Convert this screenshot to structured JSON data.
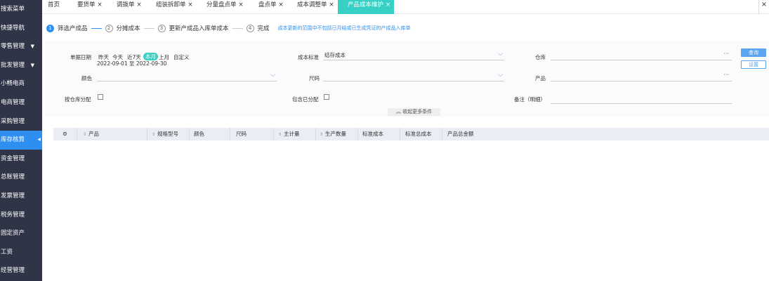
{
  "sidebar": {
    "items": [
      {
        "label": "搜索菜单"
      },
      {
        "label": "快捷导航"
      },
      {
        "label": "零售管理",
        "caret": "▼"
      },
      {
        "label": "批发管理",
        "caret": "▼"
      },
      {
        "label": "小畅电商"
      },
      {
        "label": "电商管理"
      },
      {
        "label": "采购管理"
      },
      {
        "label": "库存核算",
        "active": true,
        "caret": "◀"
      },
      {
        "label": "资金管理"
      },
      {
        "label": "总账管理"
      },
      {
        "label": "发票管理"
      },
      {
        "label": "税务管理"
      },
      {
        "label": "固定资产"
      },
      {
        "label": "工资"
      },
      {
        "label": "经营管理"
      }
    ]
  },
  "tabs": [
    {
      "label": "首页"
    },
    {
      "label": "要货单"
    },
    {
      "label": "调拨单"
    },
    {
      "label": "组装拆卸单"
    },
    {
      "label": "分量盘点单"
    },
    {
      "label": "盘点单"
    },
    {
      "label": "成本调整单"
    },
    {
      "label": "产品成本维护",
      "active": true
    }
  ],
  "tab_close_glyph": "×",
  "steps": [
    {
      "num": "1",
      "label": "筛选产成品"
    },
    {
      "num": "2",
      "label": "分摊成本"
    },
    {
      "num": "3",
      "label": "更新产成品入库单成本"
    },
    {
      "num": "4",
      "label": "完成"
    }
  ],
  "steps_note": "成本更新的范围中不包括已月结或已生成凭证的产成品入库单",
  "filters": {
    "date_label": "单据日期",
    "date_options": [
      "昨天",
      "今天",
      "近7天",
      "本月",
      "上月",
      "自定义"
    ],
    "date_selected": "本月",
    "date_range": "2022-09-01 至 2022-09-30",
    "cost_std_label": "成本标准",
    "cost_std_value": "结存成本",
    "warehouse_label": "仓库",
    "color_label": "颜色",
    "size_label": "尺码",
    "product_label": "产品",
    "by_warehouse_label": "按仓库分配",
    "include_allocated_label": "包含已分配",
    "note_label": "备注（明细）",
    "search_button": "查询",
    "settings_button": "设置",
    "collapse_label": "收起更多条件"
  },
  "table": {
    "columns": [
      "产品",
      "规格型号",
      "颜色",
      "尺码",
      "主计量",
      "生产数量",
      "标准成本",
      "标准总成本",
      "产品总金额"
    ]
  },
  "colors": {
    "sidebar_bg": "#2f3447",
    "accent_blue": "#2f8ff0",
    "accent_teal": "#36d1c4"
  },
  "icons": {
    "settings": "gear-icon",
    "close": "close-icon",
    "dropdown": "chevron-down-icon",
    "more": "ellipsis-icon"
  }
}
